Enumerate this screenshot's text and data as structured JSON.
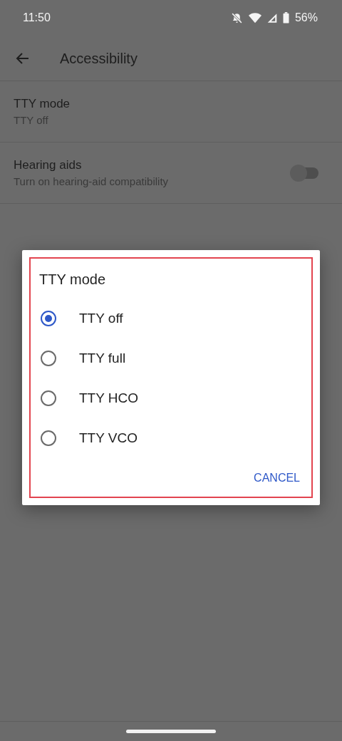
{
  "status_bar": {
    "time": "11:50",
    "battery": "56%"
  },
  "toolbar": {
    "title": "Accessibility"
  },
  "settings": [
    {
      "kind": "text",
      "title": "TTY mode",
      "summary": "TTY off"
    },
    {
      "kind": "switch",
      "title": "Hearing aids",
      "summary": "Turn on hearing-aid compatibility",
      "on": false
    }
  ],
  "dialog": {
    "title": "TTY mode",
    "highlighted": true,
    "options": [
      {
        "label": "TTY off",
        "selected": true
      },
      {
        "label": "TTY full",
        "selected": false
      },
      {
        "label": "TTY HCO",
        "selected": false
      },
      {
        "label": "TTY VCO",
        "selected": false
      }
    ],
    "buttons": [
      "CANCEL"
    ]
  }
}
